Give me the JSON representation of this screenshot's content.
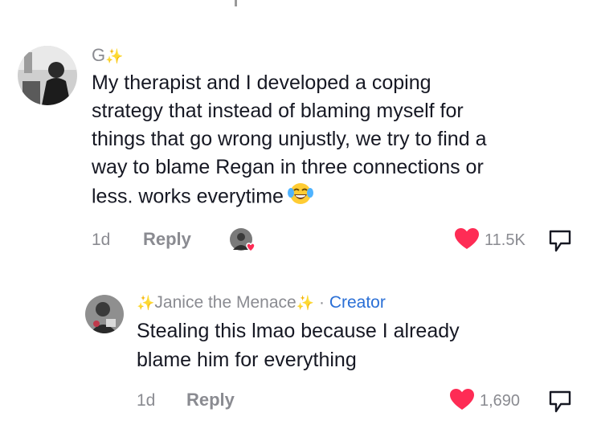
{
  "comment": {
    "username": "G",
    "text_lines": [
      "My therapist and I developed a coping",
      "strategy that instead of blaming myself for",
      "things that go wrong unjustly, we try to find a",
      "way to blame Regan in three connections or",
      "less. works everytime"
    ],
    "emoji_icon": "laughing-tears-emoji",
    "age": "1d",
    "reply_label": "Reply",
    "like_count": "11.5K",
    "liked_by_creator": true
  },
  "reply": {
    "username": "Janice the Menace",
    "separator": "·",
    "creator_badge": "Creator",
    "text_lines": [
      "Stealing this lmao because I already",
      "blame him for everything"
    ],
    "age": "1d",
    "reply_label": "Reply",
    "like_count": "1,690"
  },
  "colors": {
    "heart": "#fe2c55",
    "creator": "#2a6fd6",
    "secondary_text": "#8a8b91",
    "sparkle": "#e8c13c"
  }
}
